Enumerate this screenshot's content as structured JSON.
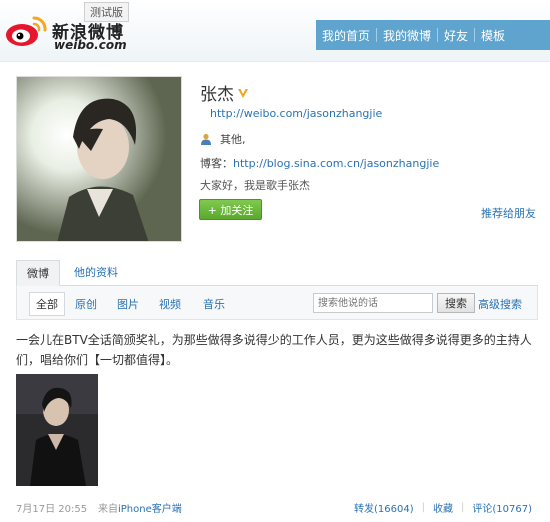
{
  "header": {
    "brand_cn": "新浪微博",
    "brand_en": "weibo.com",
    "beta": "测试版",
    "nav": [
      "我的首页",
      "我的微博",
      "好友",
      "模板"
    ]
  },
  "profile": {
    "name": "张杰",
    "url": "http://weibo.com/jasonzhangjie",
    "info": "其他,",
    "blog_label": "博客：",
    "blog_url": "http://blog.sina.com.cn/jasonzhangjie",
    "bio": "大家好，我是歌手张杰",
    "follow_label": "+ 加关注",
    "recommend_label": "推荐给朋友"
  },
  "tabs": [
    "微博",
    "他的资料"
  ],
  "filters": [
    "全部",
    "原创",
    "图片",
    "视频",
    "音乐"
  ],
  "search": {
    "placeholder": "搜索他说的话",
    "button": "搜索",
    "advanced": "高级搜索"
  },
  "post": {
    "text": "一会儿在BTV全话简颁奖礼，为那些做得多说得少的工作人员，更为这些做得多说得更多的主持人们，唱给你们【一切都值得】。",
    "time": "7月17日 20:55",
    "source_prefix": "来自",
    "source": "iPhone客户端",
    "repost": "转发(16604)",
    "favorite": "收藏",
    "comment": "评论(10767)"
  },
  "colors": {
    "nav_bg": "#5fa4cf",
    "link": "#2a72b5",
    "follow_green": "#5aa92c"
  }
}
